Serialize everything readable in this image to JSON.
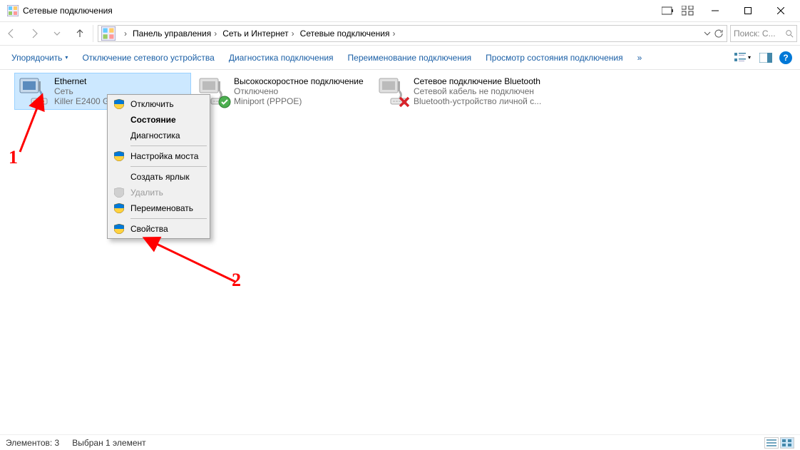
{
  "window": {
    "title": "Сетевые подключения"
  },
  "breadcrumbs": {
    "b0": "Панель управления",
    "b1": "Сеть и Интернет",
    "b2": "Сетевые подключения"
  },
  "search": {
    "placeholder": "Поиск: С..."
  },
  "cmdbar": {
    "organize": "Упорядочить",
    "disable": "Отключение сетевого устройства",
    "diagnose": "Диагностика подключения",
    "rename": "Переименование подключения",
    "status": "Просмотр состояния подключения",
    "more": "»"
  },
  "connections": [
    {
      "name": "Ethernet",
      "status": "Сеть",
      "device": "Killer E2400 Gi...",
      "selected": true,
      "badge": "none"
    },
    {
      "name": "Высокоскоростное подключение",
      "status": "Отключено",
      "device": "Miniport (PPPOE)",
      "selected": false,
      "badge": "ok"
    },
    {
      "name": "Сетевое подключение Bluetooth",
      "status": "Сетевой кабель не подключен",
      "device": "Bluetooth-устройство личной с...",
      "selected": false,
      "badge": "err"
    }
  ],
  "context_menu": {
    "disable": "Отключить",
    "status": "Состояние",
    "diagnose": "Диагностика",
    "bridge": "Настройка моста",
    "shortcut": "Создать ярлык",
    "delete": "Удалить",
    "rename": "Переименовать",
    "properties": "Свойства"
  },
  "annotations": {
    "n1": "1",
    "n2": "2"
  },
  "statusbar": {
    "count": "Элементов: 3",
    "selection": "Выбран 1 элемент"
  }
}
